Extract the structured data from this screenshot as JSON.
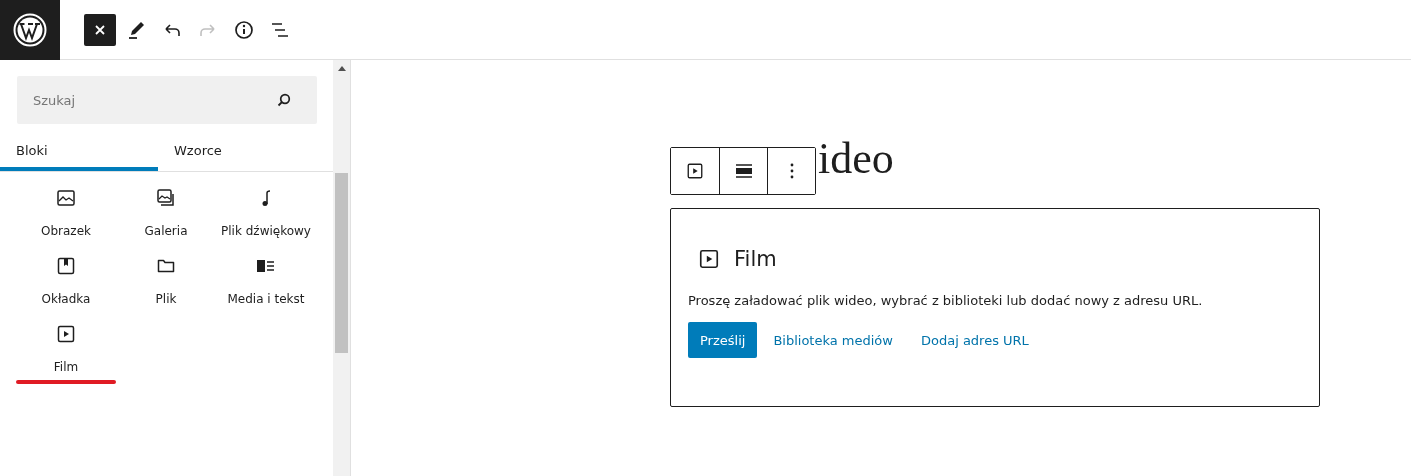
{
  "toolbar": {
    "redo_disabled": true
  },
  "search": {
    "placeholder": "Szukaj"
  },
  "tabs": [
    {
      "label": "Bloki",
      "selected": true
    },
    {
      "label": "Wzorce",
      "selected": false
    }
  ],
  "blocks": [
    {
      "kind": "image",
      "label": "Obrazek",
      "highlighted": false
    },
    {
      "kind": "gallery",
      "label": "Galeria",
      "highlighted": false
    },
    {
      "kind": "audio",
      "label": "Plik dźwiękowy",
      "highlighted": false
    },
    {
      "kind": "cover",
      "label": "Okładka",
      "highlighted": false
    },
    {
      "kind": "file",
      "label": "Plik",
      "highlighted": false
    },
    {
      "kind": "media-text",
      "label": "Media i tekst",
      "highlighted": false
    },
    {
      "kind": "video",
      "label": "Film",
      "highlighted": true
    }
  ],
  "editor": {
    "title": "ideo",
    "placeholder": {
      "title": "Film",
      "instructions": "Proszę załadować plik wideo, wybrać z biblioteki lub dodać nowy z adresu URL.",
      "upload": "Prześlij",
      "links": [
        "Biblioteka mediów",
        "Dodaj adres URL"
      ]
    }
  }
}
